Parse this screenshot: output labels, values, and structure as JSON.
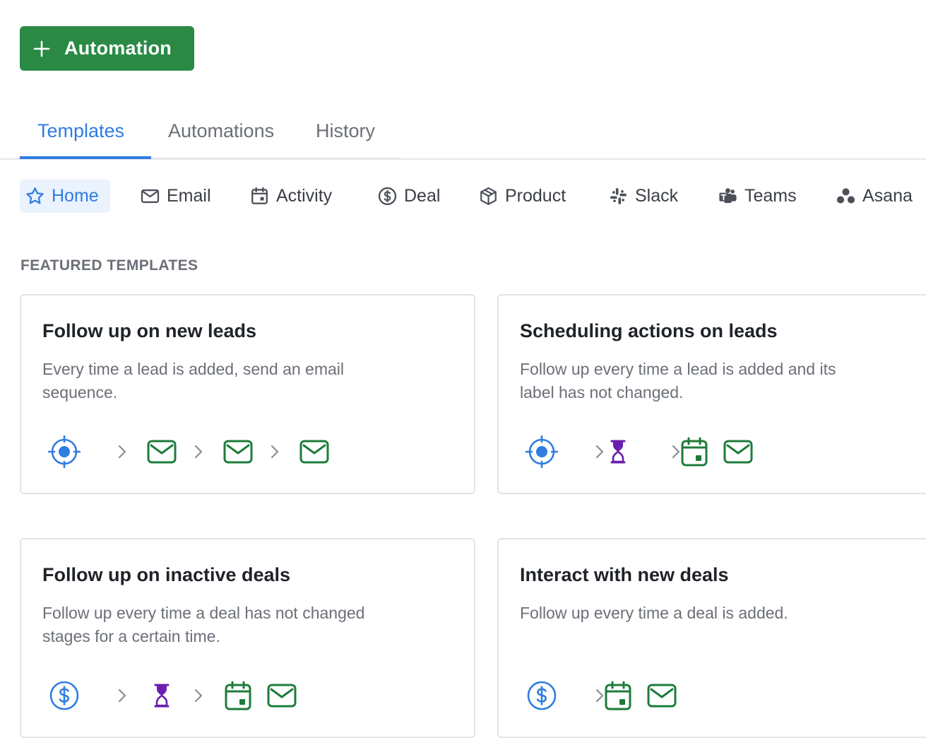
{
  "toolbar": {
    "add_label": "Automation"
  },
  "tabs": [
    {
      "label": "Templates",
      "active": true
    },
    {
      "label": "Automations",
      "active": false
    },
    {
      "label": "History",
      "active": false
    }
  ],
  "categories": [
    {
      "label": "Home",
      "icon": "star-icon",
      "active": true
    },
    {
      "label": "Email",
      "icon": "envelope-icon"
    },
    {
      "label": "Activity",
      "icon": "calendar-icon"
    },
    {
      "label": "Deal",
      "icon": "dollar-circle-icon"
    },
    {
      "label": "Product",
      "icon": "box-icon"
    },
    {
      "label": "Slack",
      "icon": "slack-icon"
    },
    {
      "label": "Teams",
      "icon": "teams-icon"
    },
    {
      "label": "Asana",
      "icon": "asana-icon"
    }
  ],
  "featured": {
    "heading": "FEATURED TEMPLATES",
    "cards": [
      {
        "title": "Follow up on new leads",
        "description": "Every time a lead is added, send an email sequence.",
        "steps": [
          "target-icon",
          "envelope-icon",
          "envelope-icon",
          "envelope-icon"
        ]
      },
      {
        "title": "Scheduling actions on leads",
        "description": "Follow up every time a lead is added and its label has not changed.",
        "steps": [
          "target-icon",
          "hourglass-icon",
          "calendar-icon",
          "envelope-icon"
        ]
      },
      {
        "title": "Follow up on inactive deals",
        "description": "Follow up every time a deal has not changed stages for a certain time.",
        "steps": [
          "dollar-circle-icon",
          "hourglass-icon",
          "calendar-icon",
          "envelope-icon"
        ]
      },
      {
        "title": "Interact with new deals",
        "description": "Follow up every time a deal is added.",
        "steps": [
          "dollar-circle-icon",
          "calendar-icon",
          "envelope-icon"
        ]
      }
    ]
  },
  "colors": {
    "primary": "#2a8a45",
    "accent": "#2f7de1",
    "trigger_blue": "#2f7de1",
    "action_green": "#1e7b3a",
    "delay_purple": "#6a1fb0"
  }
}
